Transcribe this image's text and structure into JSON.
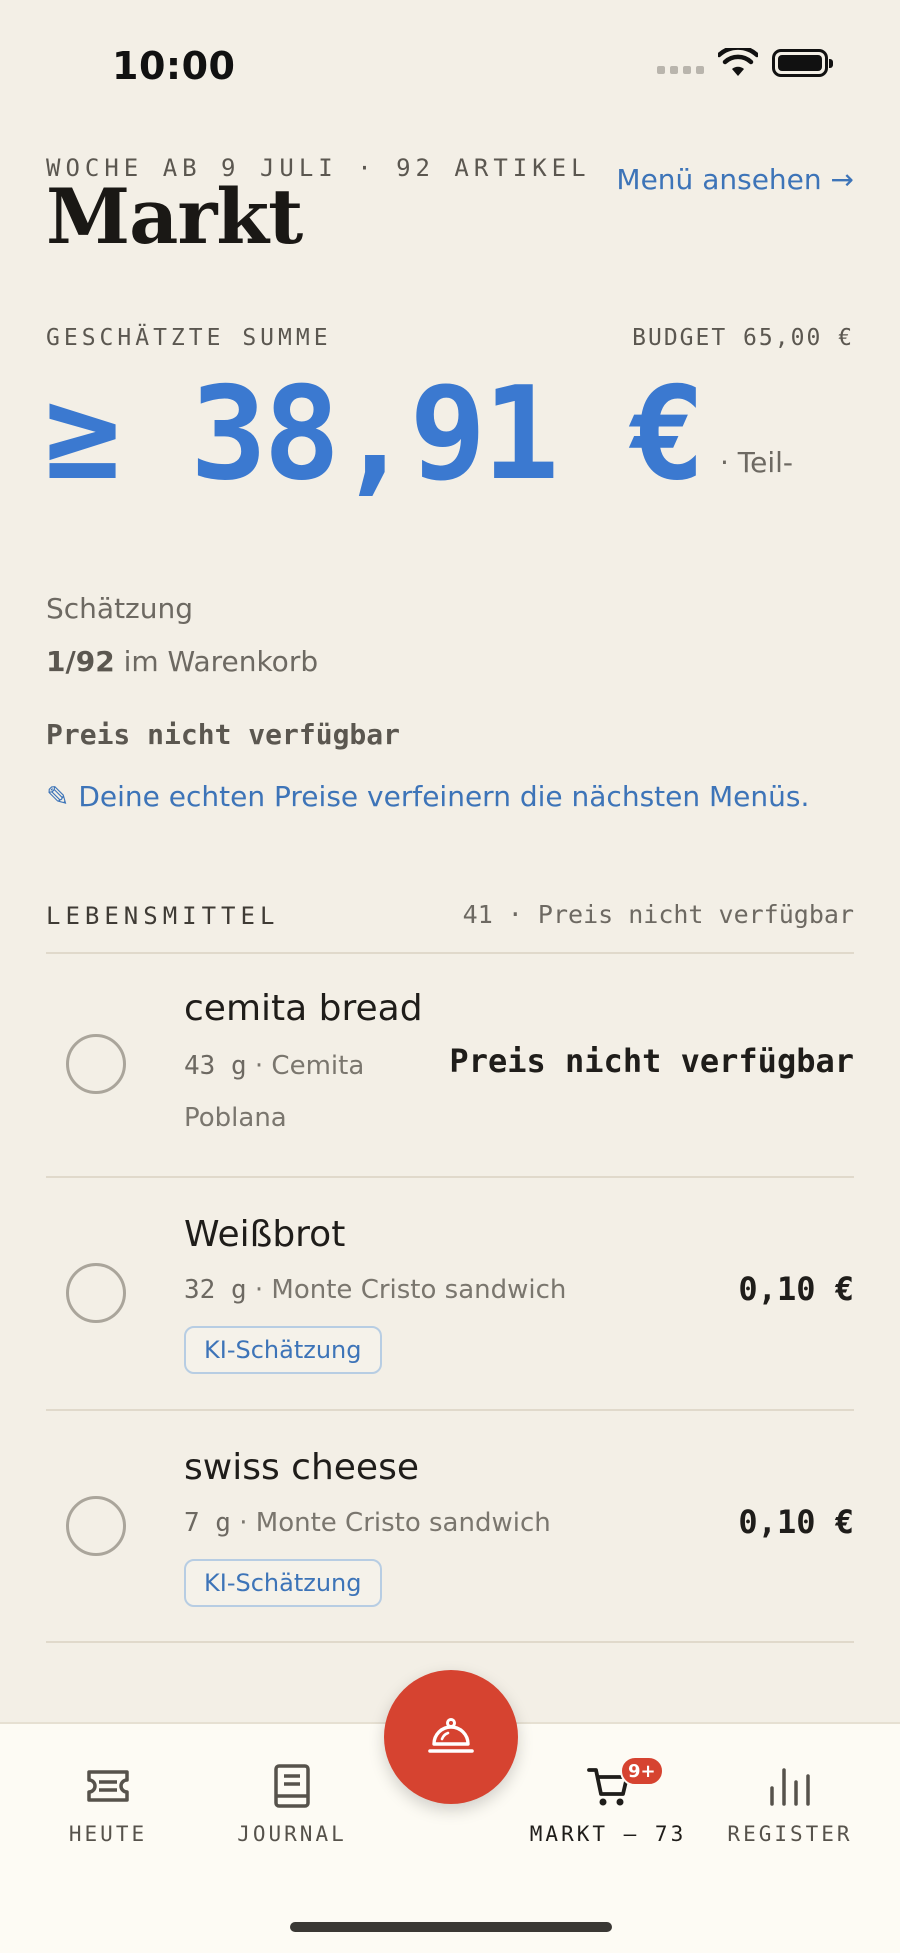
{
  "status_bar": {
    "time": "10:00"
  },
  "header": {
    "week_label": "WOCHE AB 9 JULI · 92 ARTIKEL",
    "title": "Markt",
    "menu_link": "Menü ansehen →"
  },
  "summary": {
    "total_label": "GESCHÄTZTE SUMME",
    "budget_label": "BUDGET 65,00 €",
    "total_amount": "≥ 38,91 €",
    "total_suffix": "· Teil-",
    "estimate_word": "Schätzung",
    "cart_fraction": "1/92",
    "cart_text": " im Warenkorb",
    "price_unavailable": "Preis nicht verfügbar",
    "refine_note": "✎ Deine echten Preise verfeinern die nächsten Menüs."
  },
  "section": {
    "title": "LEBENSMITTEL",
    "meta": "41 · Preis nicht verfügbar"
  },
  "items": [
    {
      "name": "cemita bread",
      "qty": "43 g",
      "recipe_line1": " · Cemita",
      "recipe_line2": "Poblana",
      "price": "Preis nicht verfügbar",
      "badge": ""
    },
    {
      "name": "Weißbrot",
      "qty": "32 g",
      "recipe_line1": " · Monte Cristo sandwich",
      "price": "0,10 €",
      "badge": "KI-Schätzung"
    },
    {
      "name": "swiss cheese",
      "qty": "7 g",
      "recipe_line1": " · Monte Cristo sandwich",
      "price": "0,10 €",
      "badge": "KI-Schätzung"
    }
  ],
  "nav": {
    "today": "HEUTE",
    "journal": "JOURNAL",
    "market": "MARKT — 73",
    "market_badge": "9+",
    "register": "REGISTER"
  },
  "colors": {
    "accent": "#3b79d0",
    "fab": "#d64330",
    "background": "#f3efe6"
  }
}
